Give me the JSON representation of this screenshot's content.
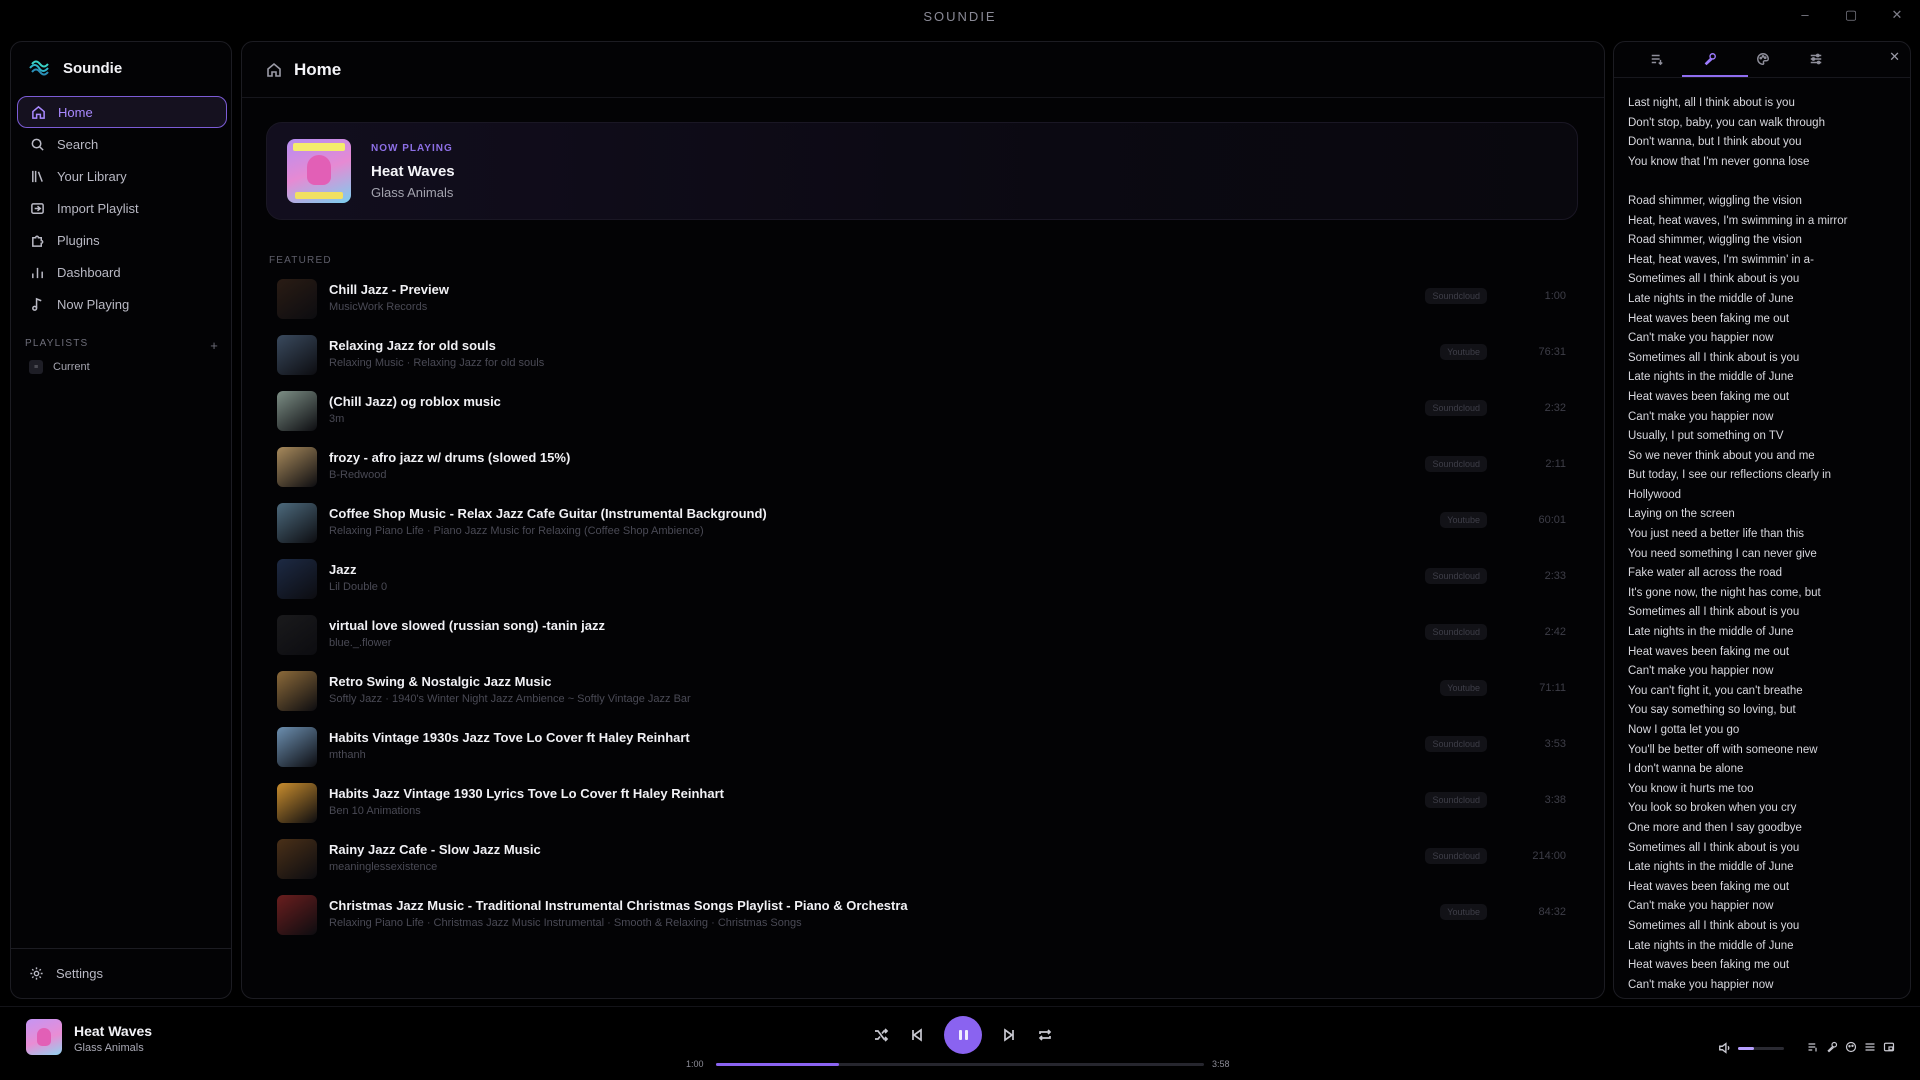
{
  "window": {
    "title": "SOUNDIE",
    "buttons": [
      "–",
      "▢",
      "✕"
    ]
  },
  "sidebar": {
    "brand": "Soundie",
    "items": [
      {
        "label": "Home",
        "icon": "home-icon",
        "active": true
      },
      {
        "label": "Search",
        "icon": "search-icon"
      },
      {
        "label": "Your Library",
        "icon": "library-icon"
      },
      {
        "label": "Import Playlist",
        "icon": "import-icon"
      },
      {
        "label": "Plugins",
        "icon": "puzzle-icon"
      },
      {
        "label": "Dashboard",
        "icon": "chart-icon"
      },
      {
        "label": "Now Playing",
        "icon": "music-note-icon"
      }
    ],
    "playlists_heading": "PLAYLISTS",
    "playlists_add": "+",
    "playlists": [
      {
        "label": "Current"
      }
    ],
    "settings_label": "Settings"
  },
  "main": {
    "title": "Home",
    "now_playing": {
      "label": "NOW PLAYING",
      "title": "Heat Waves",
      "artist": "Glass Animals"
    },
    "featured_label": "FEATURED",
    "tracks": [
      {
        "title": "Chill Jazz - Preview",
        "sub": "MusicWork Records",
        "source": "Soundcloud",
        "duration": "1:00",
        "thumb": "#2a1c14"
      },
      {
        "title": "Relaxing Jazz for old souls",
        "sub": "Relaxing Music · Relaxing Jazz for old souls",
        "source": "Youtube",
        "duration": "76:31",
        "thumb": "#3a4a5e"
      },
      {
        "title": "(Chill Jazz) og roblox music",
        "sub": "3m",
        "source": "Soundcloud",
        "duration": "2:32",
        "thumb": "#7d8f86"
      },
      {
        "title": "frozy - afro jazz w/ drums (slowed 15%)",
        "sub": "B-Redwood",
        "source": "Soundcloud",
        "duration": "2:11",
        "thumb": "#a88a5c"
      },
      {
        "title": "Coffee Shop Music - Relax Jazz Cafe Guitar (Instrumental Background)",
        "sub": "Relaxing Piano Life · Piano Jazz Music for Relaxing (Coffee Shop Ambience)",
        "source": "Youtube",
        "duration": "60:01",
        "thumb": "#4d6a7d"
      },
      {
        "title": "Jazz",
        "sub": "Lil Double 0",
        "source": "Soundcloud",
        "duration": "2:33",
        "thumb": "#1d2a44"
      },
      {
        "title": "virtual love slowed (russian song) -tanin jazz",
        "sub": "blue._.flower",
        "source": "Soundcloud",
        "duration": "2:42",
        "thumb": "#1a1a1c"
      },
      {
        "title": "Retro Swing & Nostalgic Jazz Music",
        "sub": "Softly Jazz · 1940's Winter Night Jazz Ambience ~ Softly Vintage Jazz Bar",
        "source": "Youtube",
        "duration": "71:11",
        "thumb": "#8c6a3a"
      },
      {
        "title": "Habits Vintage 1930s Jazz Tove Lo Cover ft Haley Reinhart",
        "sub": "mthanh",
        "source": "Soundcloud",
        "duration": "3:53",
        "thumb": "#6c8fb0"
      },
      {
        "title": "Habits Jazz Vintage 1930 Lyrics Tove Lo Cover ft Haley Reinhart",
        "sub": "Ben 10 Animations",
        "source": "Soundcloud",
        "duration": "3:38",
        "thumb": "#c98d2e"
      },
      {
        "title": "Rainy Jazz Cafe - Slow Jazz Music",
        "sub": "meaninglessexistence",
        "source": "Soundcloud",
        "duration": "214:00",
        "thumb": "#4a3018"
      },
      {
        "title": "Christmas Jazz Music - Traditional Instrumental Christmas Songs Playlist - Piano & Orchestra",
        "sub": "Relaxing Piano Life · Christmas Jazz Music Instrumental · Smooth & Relaxing · Christmas Songs",
        "source": "Youtube",
        "duration": "84:32",
        "thumb": "#6a1e1e"
      }
    ]
  },
  "rightpanel": {
    "tabs": [
      {
        "icon": "queue-icon"
      },
      {
        "icon": "microphone-icon",
        "active": true
      },
      {
        "icon": "palette-icon"
      },
      {
        "icon": "sliders-icon"
      }
    ],
    "close": "✕",
    "lyrics": [
      "Last night, all I think about is you",
      "Don't stop, baby, you can walk through",
      "Don't wanna, but I think about you",
      "You know that I'm never gonna lose",
      "",
      "Road shimmer, wiggling the vision",
      "Heat, heat waves, I'm swimming in a mirror",
      "Road shimmer, wiggling the vision",
      "Heat, heat waves, I'm swimmin' in a-",
      "Sometimes all I think about is you",
      "Late nights in the middle of June",
      "Heat waves been faking me out",
      "Can't make you happier now",
      "Sometimes all I think about is you",
      "Late nights in the middle of June",
      "Heat waves been faking me out",
      "Can't make you happier now",
      "Usually, I put something on TV",
      "So we never think about you and me",
      "But today, I see our reflections clearly in",
      "Hollywood",
      "Laying on the screen",
      "You just need a better life than this",
      "You need something I can never give",
      "Fake water all across the road",
      "It's gone now, the night has come, but",
      "Sometimes all I think about is you",
      "Late nights in the middle of June",
      "Heat waves been faking me out",
      "Can't make you happier now",
      "You can't fight it, you can't breathe",
      "You say something so loving, but",
      "Now I gotta let you go",
      "You'll be better off with someone new",
      "I don't wanna be alone",
      "You know it hurts me too",
      "You look so broken when you cry",
      "One more and then I say goodbye",
      "Sometimes all I think about is you",
      "Late nights in the middle of June",
      "Heat waves been faking me out",
      "Can't make you happier now",
      "Sometimes all I think about is you",
      "Late nights in the middle of June",
      "Heat waves been faking me out",
      "Can't make you happier now"
    ]
  },
  "player": {
    "title": "Heat Waves",
    "artist": "Glass Animals",
    "current_time": "1:00",
    "total_time": "3:58",
    "progress": 0.252,
    "volume": 0.35
  },
  "colors": {
    "accent": "#8a63f0",
    "background": "#000000"
  }
}
